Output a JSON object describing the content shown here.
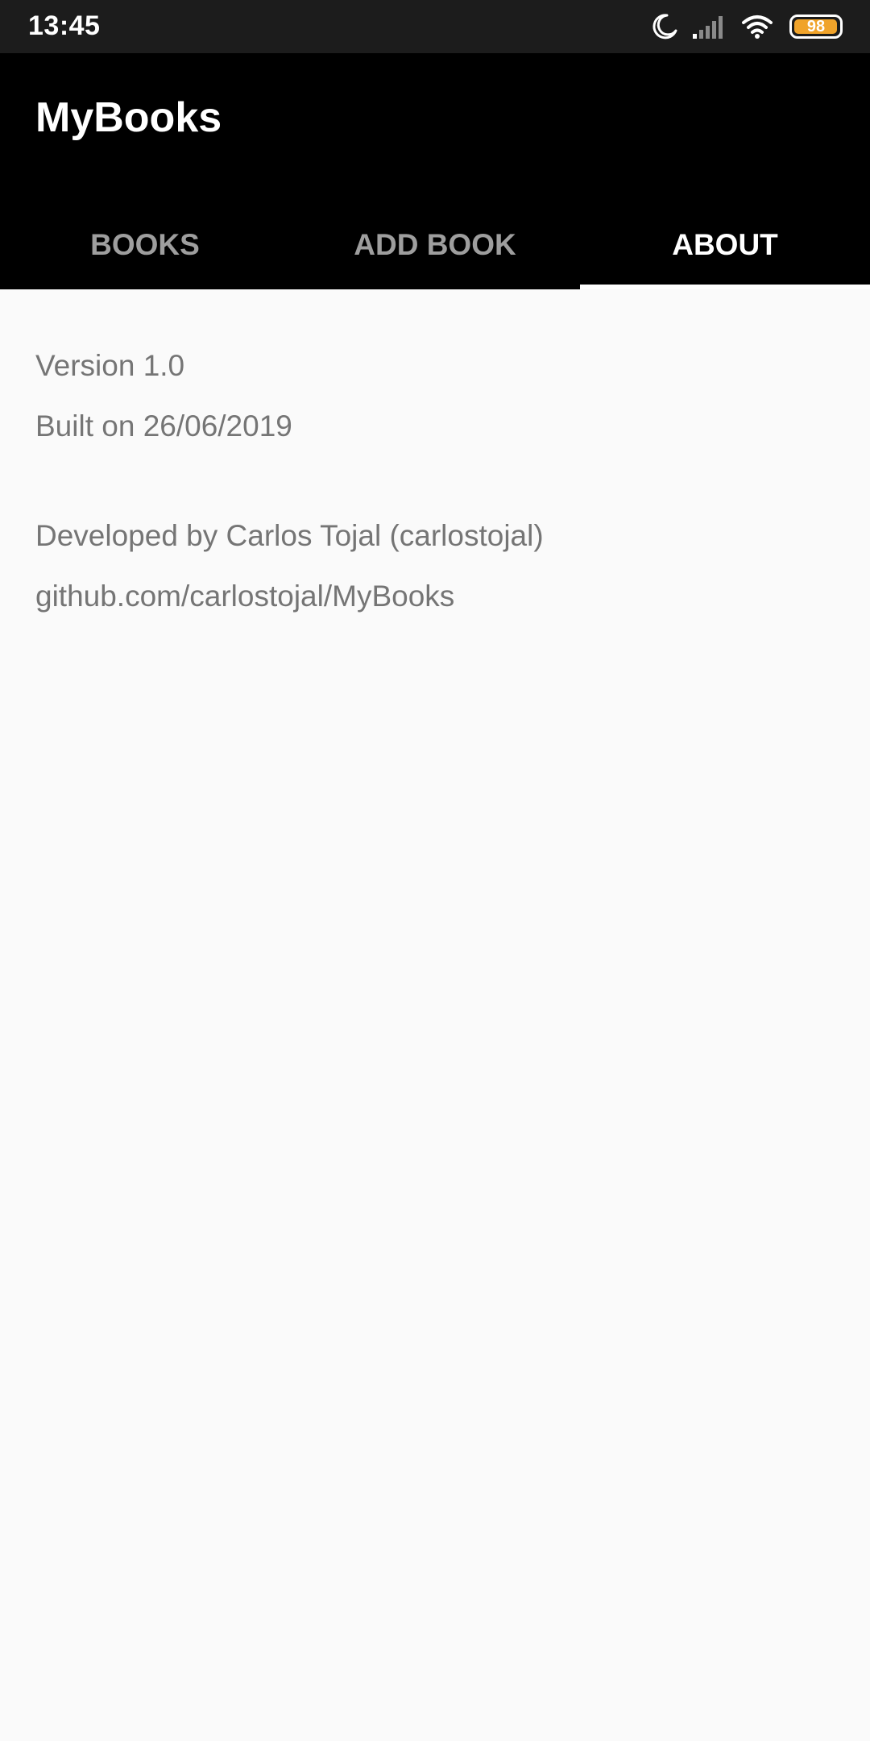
{
  "status_bar": {
    "time": "13:45",
    "battery_level": 98,
    "battery_text": "98",
    "icons": [
      "moon-icon",
      "signal-icon",
      "wifi-icon",
      "battery-icon"
    ],
    "battery_color": "#f0a32a"
  },
  "app_bar": {
    "title": "MyBooks",
    "background": "#000000",
    "tabs": [
      {
        "label": "BOOKS",
        "active": false
      },
      {
        "label": "ADD BOOK",
        "active": false
      },
      {
        "label": "ABOUT",
        "active": true
      }
    ]
  },
  "about": {
    "version": "Version 1.0",
    "built_on": "Built on 26/06/2019",
    "developer": "Developed by Carlos Tojal (carlostojal)",
    "repo": "github.com/carlostojal/MyBooks"
  }
}
